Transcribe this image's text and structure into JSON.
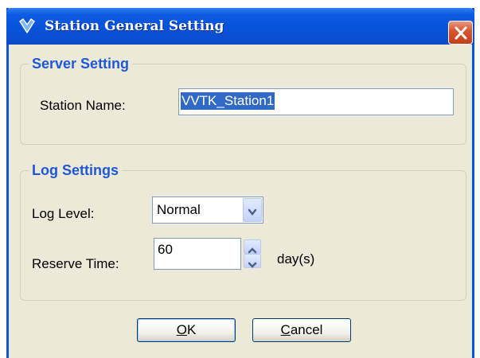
{
  "window": {
    "title": "Station General Setting"
  },
  "server_setting": {
    "legend": "Server Setting",
    "station_name_label": "Station Name:",
    "station_name_value": "VVTK_Station1"
  },
  "log_settings": {
    "legend": "Log Settings",
    "log_level_label": "Log Level:",
    "log_level_value": "Normal",
    "reserve_time_label": "Reserve Time:",
    "reserve_time_value": "60",
    "reserve_time_unit": "day(s)"
  },
  "buttons": {
    "ok_label": "OK",
    "cancel_label": "Cancel"
  },
  "colors": {
    "titlebar": "#0753dc",
    "legend_text": "#1e58d6",
    "dialog_bg": "#ece9d8",
    "selection": "#316ac5"
  },
  "icons": {
    "title": "shield-check-icon",
    "close": "close-icon",
    "dropdown": "chevron-down-icon",
    "spin_up": "chevron-up-icon",
    "spin_down": "chevron-down-icon"
  }
}
